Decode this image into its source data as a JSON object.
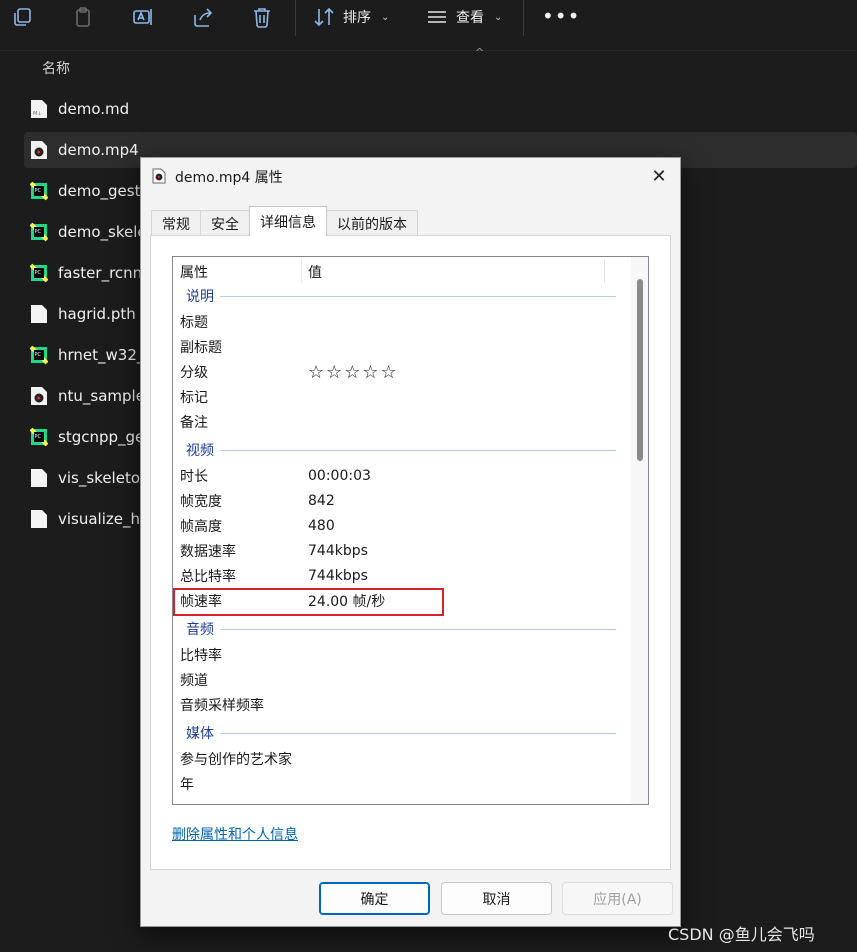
{
  "toolbar": {
    "icons": [
      "copy-icon",
      "paste-icon",
      "rename-icon",
      "share-icon",
      "delete-icon"
    ],
    "sort_label": "排序",
    "view_label": "查看",
    "more_label": "•••"
  },
  "list": {
    "column_name": "名称",
    "files": [
      {
        "name": "demo.md",
        "icon": "markdown-file-icon"
      },
      {
        "name": "demo.mp4",
        "icon": "video-file-icon",
        "selected": true
      },
      {
        "name": "demo_gestu",
        "icon": "pycharm-file-icon"
      },
      {
        "name": "demo_skele",
        "icon": "pycharm-file-icon"
      },
      {
        "name": "faster_rcnn_",
        "icon": "pycharm-file-icon"
      },
      {
        "name": "hagrid.pth",
        "icon": "blank-file-icon"
      },
      {
        "name": "hrnet_w32_",
        "icon": "pycharm-file-icon"
      },
      {
        "name": "ntu_sample.",
        "icon": "video-file-icon"
      },
      {
        "name": "stgcnpp_ge",
        "icon": "pycharm-file-icon"
      },
      {
        "name": "vis_skeletor",
        "icon": "blank-file-icon"
      },
      {
        "name": "visualize_he",
        "icon": "blank-file-icon"
      }
    ]
  },
  "dialog": {
    "title": "demo.mp4 属性",
    "tabs": [
      "常规",
      "安全",
      "详细信息",
      "以前的版本"
    ],
    "active_tab": "详细信息",
    "header": {
      "property": "属性",
      "value": "值"
    },
    "groups": {
      "description": "说明",
      "video": "视频",
      "audio": "音频",
      "media": "媒体"
    },
    "description_rows": [
      {
        "key": "标题",
        "value": ""
      },
      {
        "key": "副标题",
        "value": ""
      },
      {
        "key": "分级",
        "value": "☆☆☆☆☆"
      },
      {
        "key": "标记",
        "value": ""
      },
      {
        "key": "备注",
        "value": ""
      }
    ],
    "video_rows": [
      {
        "key": "时长",
        "value": "00:00:03"
      },
      {
        "key": "帧宽度",
        "value": "842"
      },
      {
        "key": "帧高度",
        "value": "480"
      },
      {
        "key": "数据速率",
        "value": "744kbps"
      },
      {
        "key": "总比特率",
        "value": "744kbps"
      },
      {
        "key": "帧速率",
        "value": "24.00 帧/秒"
      }
    ],
    "audio_rows": [
      {
        "key": "比特率",
        "value": ""
      },
      {
        "key": "频道",
        "value": ""
      },
      {
        "key": "音频采样频率",
        "value": ""
      }
    ],
    "media_rows": [
      {
        "key": "参与创作的艺术家",
        "value": ""
      },
      {
        "key": "年",
        "value": ""
      }
    ],
    "remove_link": "删除属性和个人信息",
    "buttons": {
      "ok": "确定",
      "cancel": "取消",
      "apply": "应用(A)"
    }
  },
  "watermark": "CSDN @鱼儿会飞吗",
  "colors": {
    "highlight_box": "#d3222a",
    "group_header": "#1e3f9a",
    "link": "#0063b1"
  }
}
